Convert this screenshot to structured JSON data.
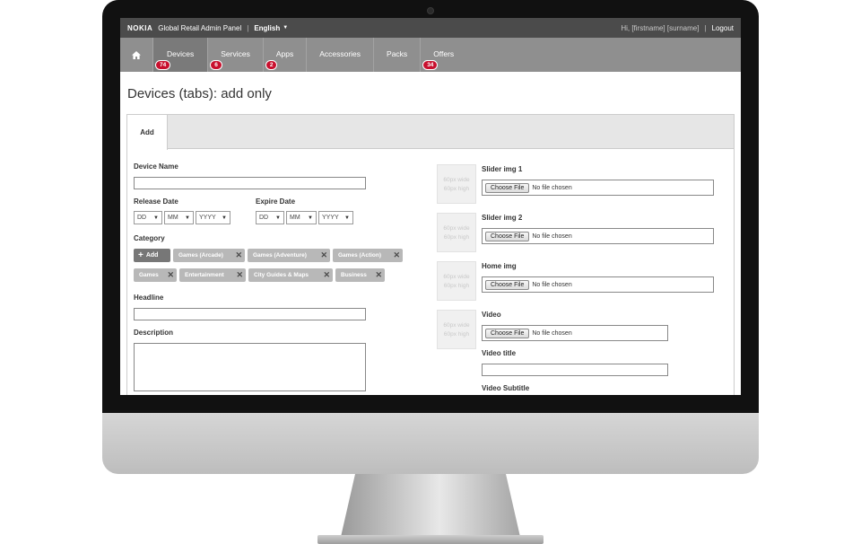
{
  "topbar": {
    "brand": "NOKIA",
    "panel_title": "Global Retail Admin Panel",
    "divider": "|",
    "language": "English",
    "greeting": "Hi, [firstname] [surname]",
    "logout": "Logout"
  },
  "nav": {
    "items": [
      {
        "label": "Devices",
        "badge": "74",
        "active": true
      },
      {
        "label": "Services",
        "badge": "6"
      },
      {
        "label": "Apps",
        "badge": "2"
      },
      {
        "label": "Accessories"
      },
      {
        "label": "Packs"
      },
      {
        "label": "Offers",
        "badge": "34"
      }
    ]
  },
  "page": {
    "title": "Devices (tabs): add only"
  },
  "tabs": [
    {
      "label": "Add"
    }
  ],
  "form": {
    "device_name_label": "Device Name",
    "release_date_label": "Release Date",
    "expire_date_label": "Expire Date",
    "date_placeholders": {
      "day": "DD",
      "month": "MM",
      "year": "YYYY"
    },
    "category_label": "Category",
    "add_label": "Add",
    "categories": [
      "Games (Arcade)",
      "Games (Adventure)",
      "Games (Action)",
      "Games",
      "Entertainment",
      "City Guides & Maps",
      "Business"
    ],
    "headline_label": "Headline",
    "description_label": "Description"
  },
  "media": {
    "placeholder_line1": "60px wide",
    "placeholder_line2": "60px high",
    "choose_file": "Choose File",
    "no_file": "No file chosen",
    "fields": [
      "Slider img 1",
      "Slider img 2",
      "Home img",
      "Video"
    ],
    "video_title_label": "Video title",
    "video_subtitle_label": "Video Subtitle"
  }
}
